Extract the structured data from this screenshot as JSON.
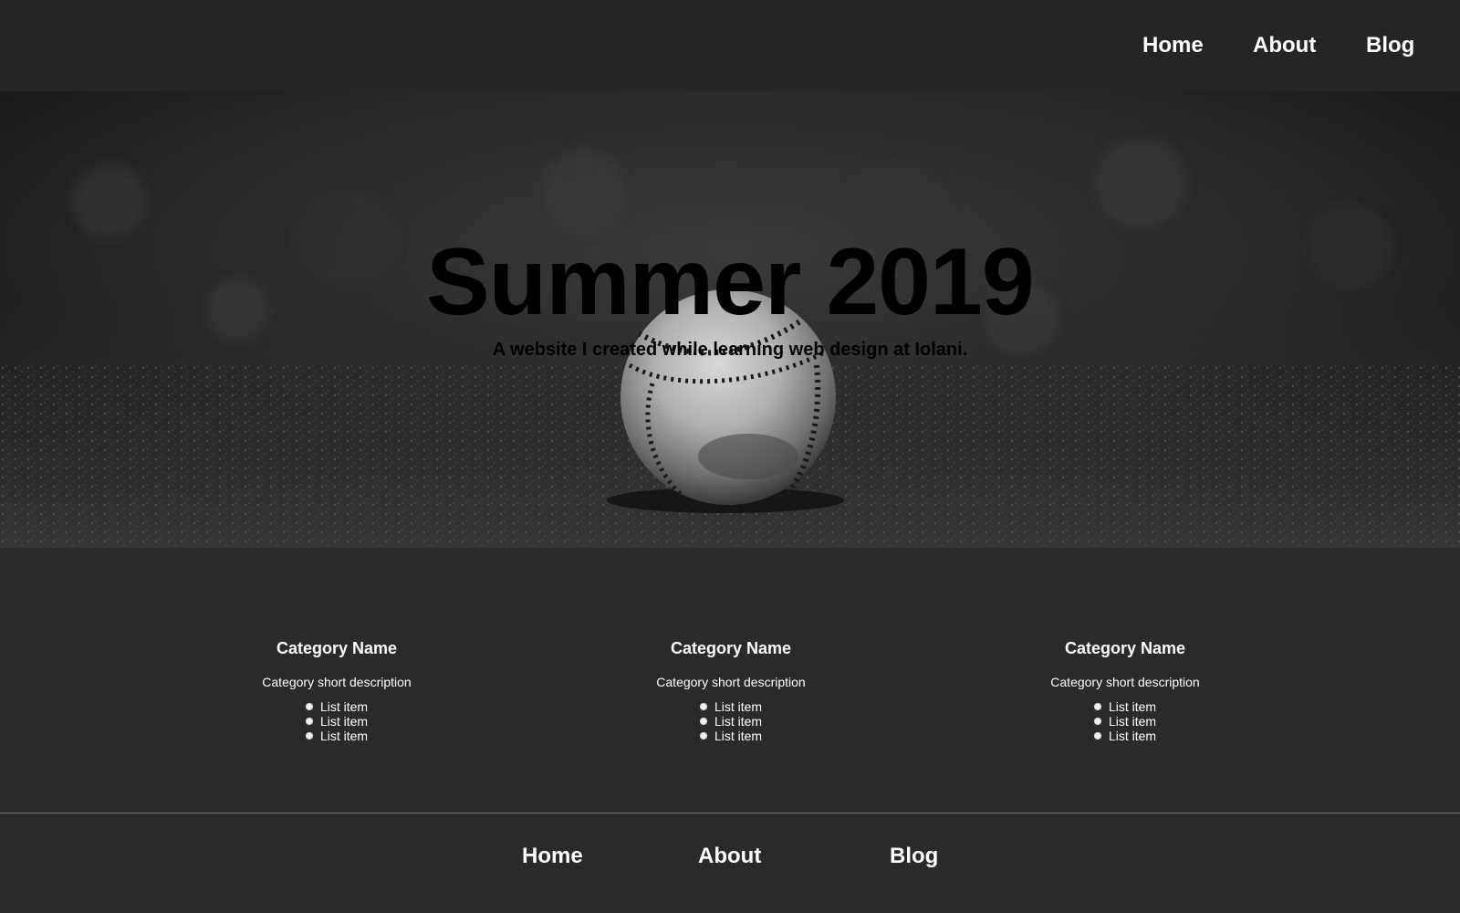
{
  "header": {
    "nav": [
      {
        "label": "Home"
      },
      {
        "label": "About"
      },
      {
        "label": "Blog"
      }
    ]
  },
  "hero": {
    "title": "Summer 2019",
    "subtitle": "A website I created while learning web design at Iolani.",
    "image": "baseball-on-dirt-photo"
  },
  "categories": [
    {
      "title": "Category Name",
      "description": "Category short description",
      "items": [
        "List item",
        "List item",
        "List item"
      ]
    },
    {
      "title": "Category Name",
      "description": "Category short description",
      "items": [
        "List item",
        "List item",
        "List item"
      ]
    },
    {
      "title": "Category Name",
      "description": "Category short description",
      "items": [
        "List item",
        "List item",
        "List item"
      ]
    }
  ],
  "footer": {
    "nav": [
      {
        "label": "Home"
      },
      {
        "label": "About"
      },
      {
        "label": "Blog"
      }
    ]
  },
  "colors": {
    "header_bg": "#252525",
    "page_bg": "#2a2a2a",
    "text": "#ffffff",
    "hero_text": "#000000",
    "divider": "#7a7a7a"
  }
}
